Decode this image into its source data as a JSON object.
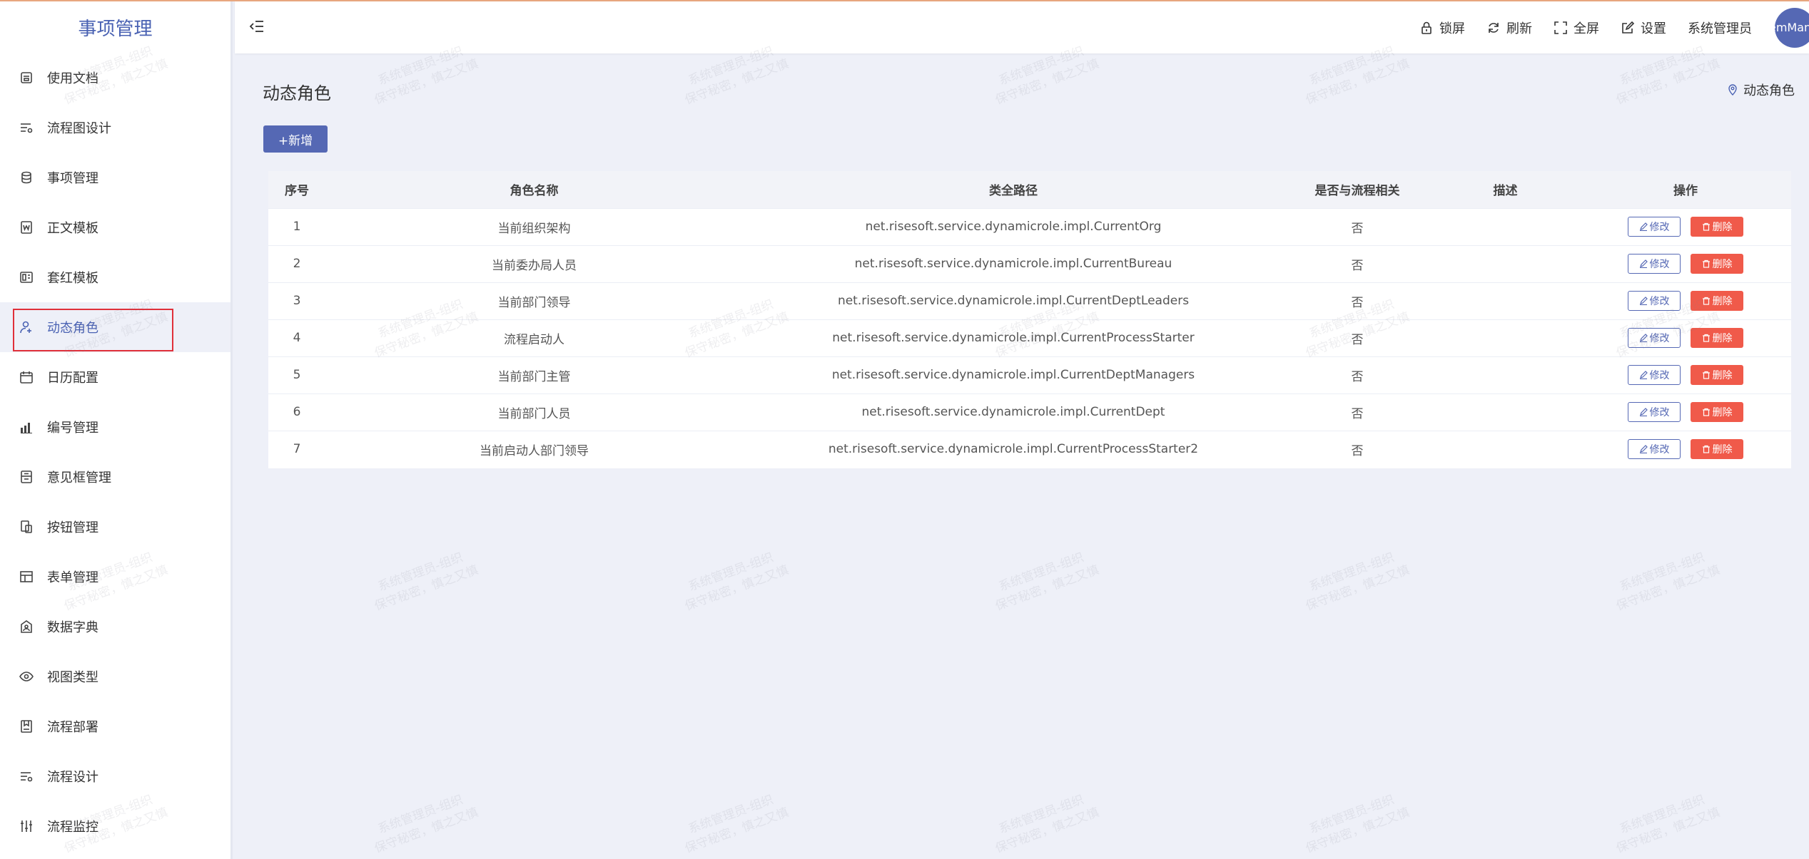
{
  "app": {
    "title": "事项管理"
  },
  "header": {
    "lock_label": "锁屏",
    "refresh_label": "刷新",
    "fullscreen_label": "全屏",
    "settings_label": "设置",
    "user_name": "系统管理员",
    "avatar_text": "emMan"
  },
  "sidebar": {
    "items": [
      {
        "label": "使用文档",
        "icon": "document-icon"
      },
      {
        "label": "流程图设计",
        "icon": "list-settings-icon"
      },
      {
        "label": "事项管理",
        "icon": "database-icon"
      },
      {
        "label": "正文模板",
        "icon": "word-file-icon"
      },
      {
        "label": "套红模板",
        "icon": "template-icon"
      },
      {
        "label": "动态角色",
        "icon": "user-add-icon"
      },
      {
        "label": "日历配置",
        "icon": "calendar-icon"
      },
      {
        "label": "编号管理",
        "icon": "bar-chart-icon"
      },
      {
        "label": "意见框管理",
        "icon": "opinion-box-icon"
      },
      {
        "label": "按钮管理",
        "icon": "button-copy-icon"
      },
      {
        "label": "表单管理",
        "icon": "table-icon"
      },
      {
        "label": "数据字典",
        "icon": "dictionary-icon"
      },
      {
        "label": "视图类型",
        "icon": "eye-icon"
      },
      {
        "label": "流程部署",
        "icon": "deploy-icon"
      },
      {
        "label": "流程设计",
        "icon": "list-settings-icon"
      },
      {
        "label": "流程监控",
        "icon": "sliders-icon"
      }
    ],
    "active_index": 5
  },
  "page": {
    "title": "动态角色",
    "breadcrumb": "动态角色",
    "add_button": "+新增"
  },
  "table": {
    "headers": [
      "序号",
      "角色名称",
      "类全路径",
      "是否与流程相关",
      "描述",
      "操作"
    ],
    "edit_label": "修改",
    "delete_label": "删除",
    "rows": [
      {
        "index": "1",
        "name": "当前组织架构",
        "path": "net.risesoft.service.dynamicrole.impl.CurrentOrg",
        "related": "否",
        "desc": ""
      },
      {
        "index": "2",
        "name": "当前委办局人员",
        "path": "net.risesoft.service.dynamicrole.impl.CurrentBureau",
        "related": "否",
        "desc": ""
      },
      {
        "index": "3",
        "name": "当前部门领导",
        "path": "net.risesoft.service.dynamicrole.impl.CurrentDeptLeaders",
        "related": "否",
        "desc": ""
      },
      {
        "index": "4",
        "name": "流程启动人",
        "path": "net.risesoft.service.dynamicrole.impl.CurrentProcessStarter",
        "related": "否",
        "desc": ""
      },
      {
        "index": "5",
        "name": "当前部门主管",
        "path": "net.risesoft.service.dynamicrole.impl.CurrentDeptManagers",
        "related": "否",
        "desc": ""
      },
      {
        "index": "6",
        "name": "当前部门人员",
        "path": "net.risesoft.service.dynamicrole.impl.CurrentDept",
        "related": "否",
        "desc": ""
      },
      {
        "index": "7",
        "name": "当前启动人部门领导",
        "path": "net.risesoft.service.dynamicrole.impl.CurrentProcessStarter2",
        "related": "否",
        "desc": ""
      }
    ]
  },
  "watermark": {
    "line1": "系统管理员-组织",
    "line2": "保守秘密，慎之又慎"
  },
  "colors": {
    "accent": "#5568b4",
    "danger": "#f05a4a",
    "active_outline": "#e0303a"
  }
}
